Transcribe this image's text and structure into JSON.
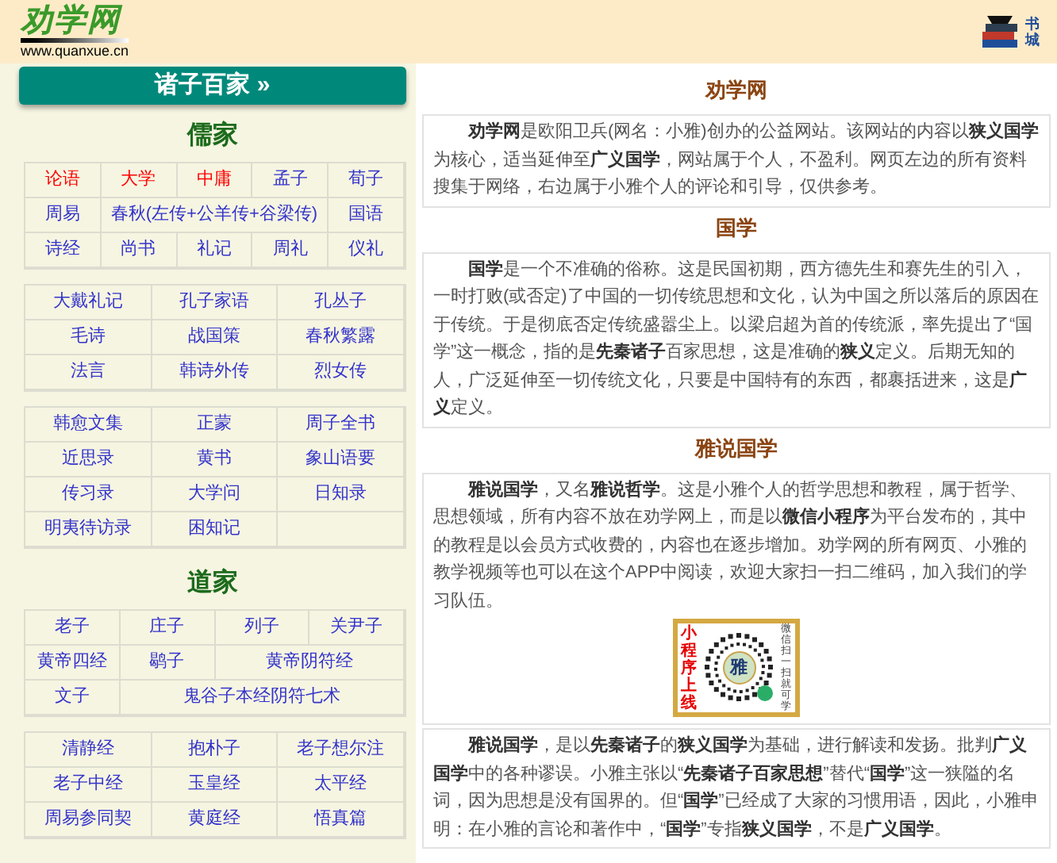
{
  "header": {
    "logo": "劝学网",
    "url": "www.quanxue.cn",
    "shop_label": "书城"
  },
  "sidebar": {
    "banner": "诸子百家 »",
    "groups": [
      {
        "title": "儒家",
        "tables": [
          {
            "rows": [
              [
                {
                  "text": "论语",
                  "highlighted": true
                },
                {
                  "text": "大学",
                  "highlighted": true
                },
                {
                  "text": "中庸",
                  "highlighted": true
                },
                {
                  "text": "孟子",
                  "highlighted": false
                },
                {
                  "text": "荀子",
                  "highlighted": false
                }
              ],
              [
                {
                  "text": "周易",
                  "highlighted": false
                },
                {
                  "text": "春秋(左传+公羊传+谷梁传)",
                  "highlighted": false,
                  "colspan": 3
                },
                {
                  "text": "国语",
                  "highlighted": false
                }
              ],
              [
                {
                  "text": "诗经",
                  "highlighted": false
                },
                {
                  "text": "尚书",
                  "highlighted": false
                },
                {
                  "text": "礼记",
                  "highlighted": false
                },
                {
                  "text": "周礼",
                  "highlighted": false
                },
                {
                  "text": "仪礼",
                  "highlighted": false
                }
              ]
            ]
          },
          {
            "rows": [
              [
                {
                  "text": "大戴礼记",
                  "highlighted": false
                },
                {
                  "text": "孔子家语",
                  "highlighted": false
                },
                {
                  "text": "孔丛子",
                  "highlighted": false
                }
              ],
              [
                {
                  "text": "毛诗",
                  "highlighted": false
                },
                {
                  "text": "战国策",
                  "highlighted": false
                },
                {
                  "text": "春秋繁露",
                  "highlighted": false
                }
              ],
              [
                {
                  "text": "法言",
                  "highlighted": false
                },
                {
                  "text": "韩诗外传",
                  "highlighted": false
                },
                {
                  "text": "烈女传",
                  "highlighted": false
                }
              ]
            ]
          },
          {
            "rows": [
              [
                {
                  "text": "韩愈文集",
                  "highlighted": false
                },
                {
                  "text": "正蒙",
                  "highlighted": false
                },
                {
                  "text": "周子全书",
                  "highlighted": false
                }
              ],
              [
                {
                  "text": "近思录",
                  "highlighted": false
                },
                {
                  "text": "黄书",
                  "highlighted": false
                },
                {
                  "text": "象山语要",
                  "highlighted": false
                }
              ],
              [
                {
                  "text": "传习录",
                  "highlighted": false
                },
                {
                  "text": "大学问",
                  "highlighted": false
                },
                {
                  "text": "日知录",
                  "highlighted": false
                }
              ],
              [
                {
                  "text": "明夷待访录",
                  "highlighted": false
                },
                {
                  "text": "困知记",
                  "highlighted": false
                }
              ]
            ]
          }
        ]
      },
      {
        "title": "道家",
        "tables": [
          {
            "rows": [
              [
                {
                  "text": "老子",
                  "highlighted": false
                },
                {
                  "text": "庄子",
                  "highlighted": false
                },
                {
                  "text": "列子",
                  "highlighted": false
                },
                {
                  "text": "关尹子",
                  "highlighted": false
                }
              ],
              [
                {
                  "text": "黄帝四经",
                  "highlighted": false
                },
                {
                  "text": "鹖子",
                  "highlighted": false
                },
                {
                  "text": "黄帝阴符经",
                  "highlighted": false,
                  "colspan": 2
                }
              ],
              [
                {
                  "text": "文子",
                  "highlighted": false
                },
                {
                  "text": "鬼谷子本经阴符七术",
                  "highlighted": false,
                  "colspan": 3
                }
              ]
            ]
          },
          {
            "rows": [
              [
                {
                  "text": "清静经",
                  "highlighted": false
                },
                {
                  "text": "抱朴子",
                  "highlighted": false
                },
                {
                  "text": "老子想尔注",
                  "highlighted": false
                }
              ],
              [
                {
                  "text": "老子中经",
                  "highlighted": false
                },
                {
                  "text": "玉皇经",
                  "highlighted": false
                },
                {
                  "text": "太平经",
                  "highlighted": false
                }
              ],
              [
                {
                  "text": "周易参同契",
                  "highlighted": false
                },
                {
                  "text": "黄庭经",
                  "highlighted": false
                },
                {
                  "text": "悟真篇",
                  "highlighted": false
                }
              ]
            ]
          }
        ]
      }
    ]
  },
  "main": {
    "sections": [
      {
        "title": "劝学网",
        "boxes": [
          {
            "kind": "text",
            "text": "**劝学网**是欧阳卫兵(网名：小雅)创办的公益网站。该网站的内容以**狭义国学**为核心，适当延伸至**广义国学**，网站属于个人，不盈利。网页左边的所有资料搜集于网络，右边属于小雅个人的评论和引导，仅供参考。"
          }
        ]
      },
      {
        "title": "国学",
        "boxes": [
          {
            "kind": "text",
            "text": "**国学**是一个不准确的俗称。这是民国初期，西方德先生和赛先生的引入，一时打败(或否定)了中国的一切传统思想和文化，认为中国之所以落后的原因在于传统。于是彻底否定传统盛嚣尘上。以梁启超为首的传统派，率先提出了“国学”这一概念，指的是**先秦诸子**百家思想，这是准确的**狭义**定义。后期无知的人，广泛延伸至一切传统文化，只要是中国特有的东西，都裹括进来，这是**广义**定义。"
          }
        ]
      },
      {
        "title": "雅说国学",
        "boxes": [
          {
            "kind": "text_qr",
            "text": "**雅说国学**，又名**雅说哲学**。这是小雅个人的哲学思想和教程，属于哲学、思想领域，所有内容不放在劝学网上，而是以**微信小程序**为平台发布的，其中的教程是以会员方式收费的，内容也在逐步增加。劝学网的所有网页、小雅的教学视频等也可以在这个APP中阅读，欢迎大家扫一扫二维码，加入我们的学习队伍。",
            "qr_left": "小程序上线",
            "qr_center": "雅",
            "qr_right": "微信扫一扫就可学"
          },
          {
            "kind": "text",
            "text": "**雅说国学**，是以**先秦诸子**的**狭义国学**为基础，进行解读和发扬。批判**广义国学**中的各种谬误。小雅主张以“**先秦诸子百家思想**”替代“**国学**”这一狭隘的名词，因为思想是没有国界的。但“**国学**”已经成了大家的习惯用语，因此，小雅申明：在小雅的言论和著作中，“**国学**”专指**狭义国学**，不是**广义国学**。"
          }
        ]
      }
    ]
  }
}
